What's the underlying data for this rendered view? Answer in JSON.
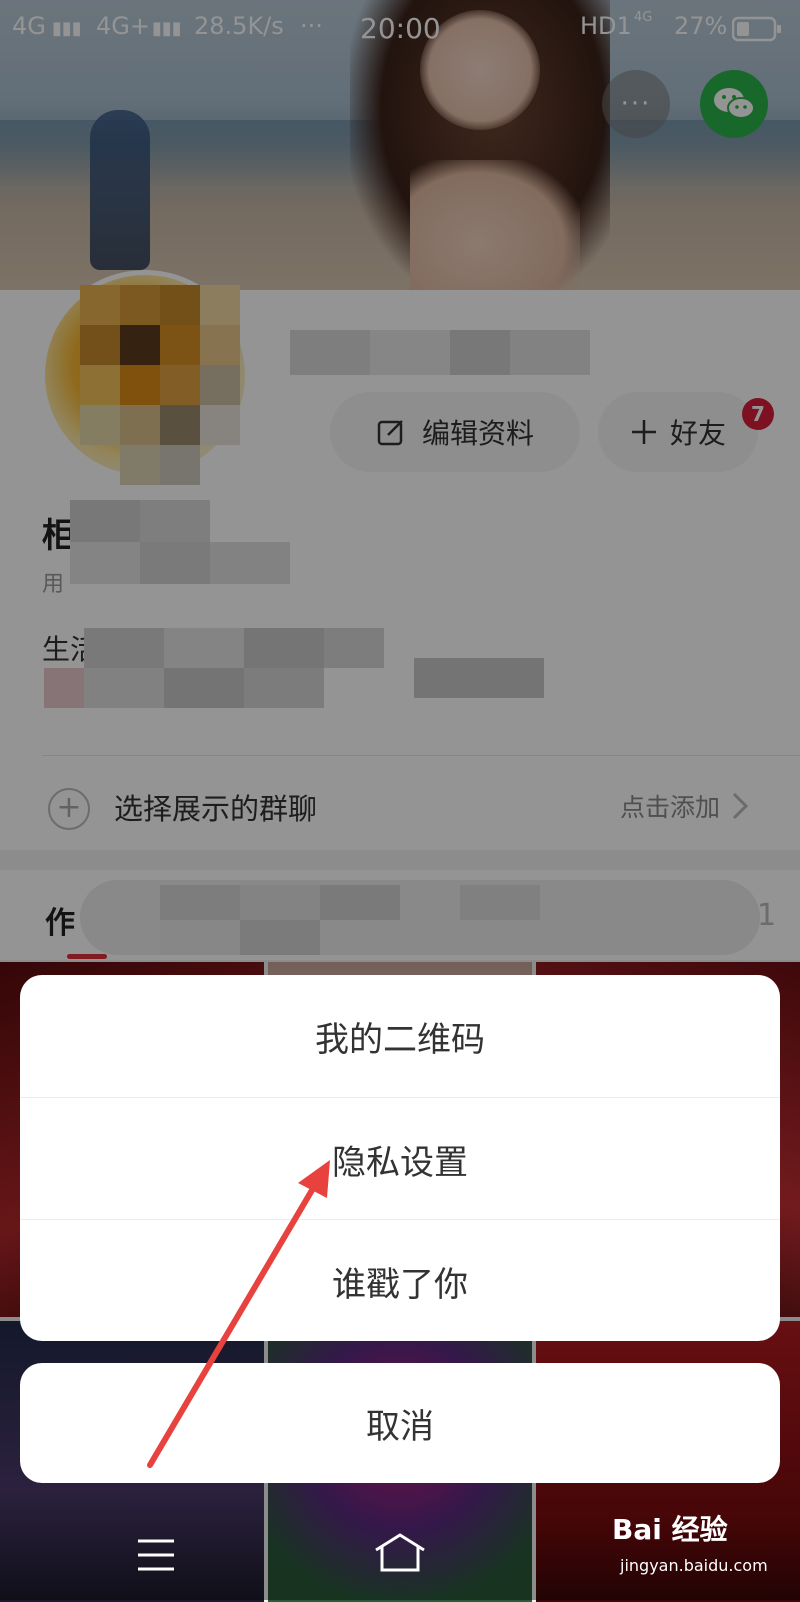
{
  "status_bar": {
    "signal_1": "4G",
    "signal_2": "4G+",
    "speed": "28.5K/s",
    "dots": "···",
    "time": "20:00",
    "network": "HD1",
    "network_sub": "4G",
    "battery": "27%"
  },
  "header": {
    "more_label": "···"
  },
  "profile": {
    "edit_label": "编辑资料",
    "friend_label": "好友",
    "friend_badge": "7",
    "name_fragment": "柜",
    "sub_fragment": "用",
    "life_fragment": "生活"
  },
  "group": {
    "label": "选择展示的群聊",
    "action": "点击添加"
  },
  "tabs": {
    "first_fragment": "作",
    "count": "1"
  },
  "sheet": {
    "items": [
      {
        "label": "我的二维码"
      },
      {
        "label": "隐私设置"
      },
      {
        "label": "谁戳了你"
      }
    ],
    "cancel": "取消"
  },
  "watermark": {
    "text": "Bai 经验",
    "url": "jingyan.baidu.com"
  },
  "colors": {
    "wechat_green": "#2cb34a",
    "badge_red": "#d81e3a",
    "arrow_red": "#e8423f"
  }
}
